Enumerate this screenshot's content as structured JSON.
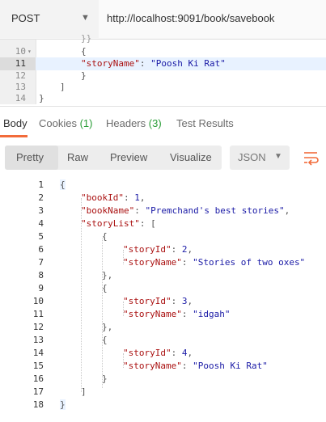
{
  "request": {
    "method": "POST",
    "url": "http://localhost:9091/book/savebook"
  },
  "request_body": {
    "lines": [
      {
        "num": "10",
        "fold": true,
        "text": "{"
      },
      {
        "num": "11",
        "key": "\"storyName\"",
        "sep": ": ",
        "value": "\"Poosh Ki Rat\""
      },
      {
        "num": "12",
        "text": "}"
      },
      {
        "num": "13",
        "text": "]"
      },
      {
        "num": "14",
        "text": "}"
      }
    ]
  },
  "response_tabs": [
    {
      "label": "Body",
      "active": true
    },
    {
      "label": "Cookies",
      "count": "(1)"
    },
    {
      "label": "Headers",
      "count": "(3)"
    },
    {
      "label": "Test Results"
    }
  ],
  "view_modes": [
    "Pretty",
    "Raw",
    "Preview",
    "Visualize"
  ],
  "format": "JSON",
  "response_lines": [
    {
      "num": "1",
      "text": "{"
    },
    {
      "num": "2",
      "key": "\"bookId\"",
      "sep": ": ",
      "value": "1",
      "tail": ","
    },
    {
      "num": "3",
      "key": "\"bookName\"",
      "sep": ": ",
      "value": "\"Premchand's best stories\"",
      "tail": ","
    },
    {
      "num": "4",
      "key": "\"storyList\"",
      "sep": ": ",
      "tail": "["
    },
    {
      "num": "5",
      "text": "{"
    },
    {
      "num": "6",
      "key": "\"storyId\"",
      "sep": ": ",
      "value": "2",
      "tail": ","
    },
    {
      "num": "7",
      "key": "\"storyName\"",
      "sep": ": ",
      "value": "\"Stories of two oxes\""
    },
    {
      "num": "8",
      "text": "},"
    },
    {
      "num": "9",
      "text": "{"
    },
    {
      "num": "10",
      "key": "\"storyId\"",
      "sep": ": ",
      "value": "3",
      "tail": ","
    },
    {
      "num": "11",
      "key": "\"storyName\"",
      "sep": ": ",
      "value": "\"idgah\""
    },
    {
      "num": "12",
      "text": "},"
    },
    {
      "num": "13",
      "text": "{"
    },
    {
      "num": "14",
      "key": "\"storyId\"",
      "sep": ": ",
      "value": "4",
      "tail": ","
    },
    {
      "num": "15",
      "key": "\"storyName\"",
      "sep": ": ",
      "value": "\"Poosh Ki Rat\""
    },
    {
      "num": "16",
      "text": "}"
    },
    {
      "num": "17",
      "text": "]"
    },
    {
      "num": "18",
      "text": "}"
    }
  ],
  "colors": {
    "key": "#a11111",
    "string": "#1a1aa6",
    "accent": "#f26b3a",
    "count": "#2a9d37"
  },
  "icons": {
    "method_dropdown": "caret-down-icon",
    "format_dropdown": "caret-down-icon",
    "wrap": "wrap-lines-icon"
  }
}
